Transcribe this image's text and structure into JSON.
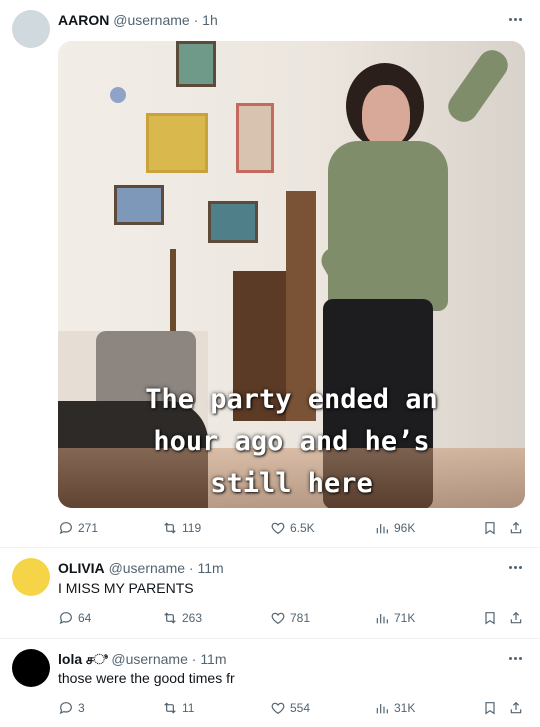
{
  "posts": [
    {
      "name": "AARON",
      "handle": "@username",
      "time": "1h",
      "avatar_color": "#cfd9de",
      "media_caption": "The party ended an\nhour ago and he’s\nstill here",
      "stats": {
        "replies": "271",
        "reposts": "119",
        "likes": "6.5K",
        "views": "96K"
      }
    },
    {
      "name": "OLIVIA",
      "handle": "@username",
      "time": "11m",
      "text": "I MISS MY PARENTS",
      "avatar_color": "#f5d547",
      "stats": {
        "replies": "64",
        "reposts": "263",
        "likes": "781",
        "views": "71K"
      }
    },
    {
      "name": "lola சಿ",
      "handle": "@username",
      "time": "11m",
      "text": "those were the good times fr",
      "avatar_color": "#000000",
      "stats": {
        "replies": "3",
        "reposts": "11",
        "likes": "554",
        "views": "31K"
      }
    }
  ],
  "separator": "·",
  "icons": [
    "reply-icon",
    "repost-icon",
    "like-icon",
    "views-icon",
    "bookmark-icon",
    "share-icon",
    "more-icon"
  ]
}
